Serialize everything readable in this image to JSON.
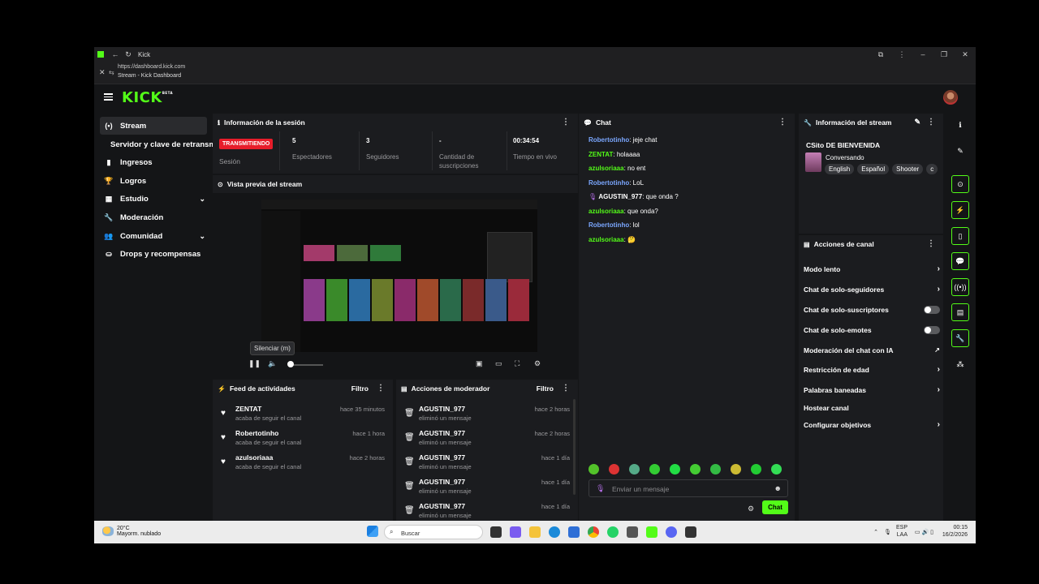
{
  "browser": {
    "tab_title": "Kick",
    "url": "https://dashboard.kick.com",
    "page_title": "Stream - Kick Dashboard"
  },
  "header": {
    "logo": "KICK",
    "logo_badge": "BETA"
  },
  "sidebar": {
    "items": [
      {
        "label": "Stream",
        "icon": "stream-icon",
        "active": true
      },
      {
        "label": "Servidor y clave de retransmisión"
      },
      {
        "label": "Ingresos",
        "icon": "bar-chart-icon"
      },
      {
        "label": "Logros",
        "icon": "trophy-icon"
      },
      {
        "label": "Estudio",
        "icon": "studio-icon"
      },
      {
        "label": "Moderación",
        "icon": "wrench-icon"
      },
      {
        "label": "Comunidad",
        "icon": "community-icon"
      },
      {
        "label": "Drops y recompensas",
        "icon": "drops-icon"
      }
    ]
  },
  "session": {
    "title": "Información de la sesión",
    "live_badge": "TRANSMITIENDO",
    "session_label": "Sesión",
    "stats": [
      {
        "value": "5",
        "label": "Espectadores"
      },
      {
        "value": "3",
        "label": "Seguidores"
      },
      {
        "value": "-",
        "label": "Cantidad de suscripciones"
      },
      {
        "value": "00:34:54",
        "label": "Tiempo en vivo"
      }
    ]
  },
  "preview": {
    "title": "Vista previa del stream",
    "tooltip": "Silenciar (m)"
  },
  "feed": {
    "title": "Feed de actividades",
    "filter": "Filtro",
    "items": [
      {
        "name": "ZENTAT",
        "text": "acaba de seguir el canal",
        "time": "hace 35 minutos"
      },
      {
        "name": "Robertotinho",
        "text": "acaba de seguir el canal",
        "time": "hace 1 hora"
      },
      {
        "name": "azulsoriaaa",
        "text": "acaba de seguir el canal",
        "time": "hace 2 horas"
      }
    ]
  },
  "mod_actions": {
    "title": "Acciones de moderador",
    "filter": "Filtro",
    "items": [
      {
        "name": "AGUSTIN_977",
        "text": "eliminó un mensaje",
        "time": "hace 2 horas"
      },
      {
        "name": "AGUSTIN_977",
        "text": "eliminó un mensaje",
        "time": "hace 2 horas"
      },
      {
        "name": "AGUSTIN_977",
        "text": "eliminó un mensaje",
        "time": "hace 1 día"
      },
      {
        "name": "AGUSTIN_977",
        "text": "eliminó un mensaje",
        "time": "hace 1 día"
      },
      {
        "name": "AGUSTIN_977",
        "text": "eliminó un mensaje",
        "time": "hace 1 día"
      }
    ]
  },
  "chat": {
    "title": "Chat",
    "messages": [
      {
        "user": "Robertotinho",
        "text": ": jeje chat",
        "color": "#7ba7ff"
      },
      {
        "user": "ZENTAT",
        "text": ": holaaaa",
        "color": "#53fc18"
      },
      {
        "user": "azulsoriaaa",
        "text": ": no ent",
        "color": "#53fc18"
      },
      {
        "user": "Robertotinho",
        "text": ": LoL",
        "color": "#7ba7ff"
      },
      {
        "user": "AGUSTIN_977",
        "text": ": que onda ?",
        "color": "#ffffff"
      },
      {
        "user": "azulsoriaaa",
        "text": ": que onda?",
        "color": "#53fc18"
      },
      {
        "user": "Robertotinho",
        "text": ": lol",
        "color": "#7ba7ff"
      },
      {
        "user": "azulsoriaaa",
        "text": ": 🤔",
        "color": "#53fc18"
      }
    ],
    "input_placeholder": "Enviar un mensaje",
    "send_label": "Chat"
  },
  "stream_info": {
    "title": "Información del stream",
    "stream_title": "CSito DE BIENVENIDA",
    "category": "Conversando",
    "tags": [
      "English",
      "Español",
      "Shooter",
      "c"
    ]
  },
  "channel_actions": {
    "title": "Acciones de canal",
    "items": [
      {
        "label": "Modo lento",
        "control": "arrow"
      },
      {
        "label": "Chat de solo-seguidores",
        "control": "arrow"
      },
      {
        "label": "Chat de solo-suscriptores",
        "control": "toggle"
      },
      {
        "label": "Chat de solo-emotes",
        "control": "toggle"
      },
      {
        "label": "Moderación del chat con IA",
        "control": "chart"
      },
      {
        "label": "Restricción de edad",
        "control": "arrow"
      },
      {
        "label": "Palabras baneadas",
        "control": "arrow"
      },
      {
        "label": "Hostear canal",
        "control": "none"
      },
      {
        "label": "Configurar objetivos",
        "control": "arrow"
      }
    ]
  },
  "taskbar": {
    "temp": "20°C",
    "weather": "Mayorm. nublado",
    "search": "Buscar",
    "lang": "ESP",
    "lang2": "LAA",
    "time": "00:15",
    "date": "16/2/2026"
  },
  "colors": {
    "brand": "#53fc18",
    "live": "#e71d2a",
    "panel": "#1b1c1f",
    "background": "#141517"
  }
}
